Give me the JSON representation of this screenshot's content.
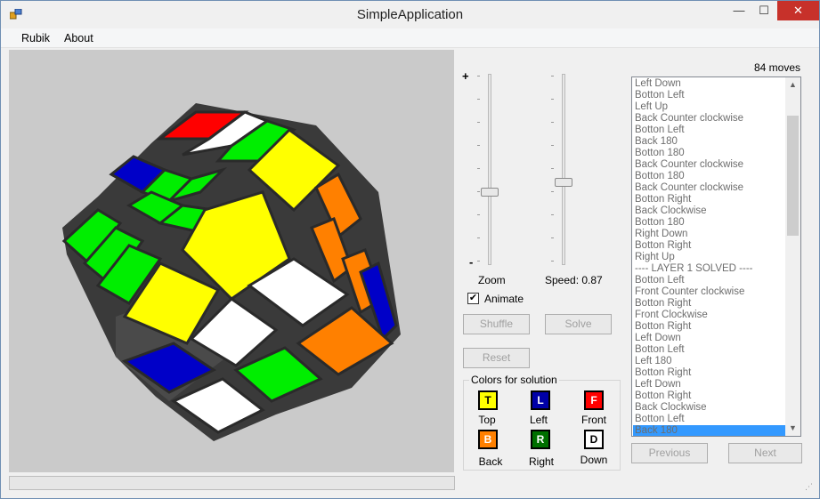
{
  "window": {
    "title": "SimpleApplication"
  },
  "menu": {
    "rubik": "Rubik",
    "about": "About"
  },
  "controls": {
    "zoom_plus": "+",
    "zoom_minus": "-",
    "zoom_label": "Zoom",
    "speed_label": "Speed: 0.87",
    "animate_label": "Animate",
    "animate_checked": true,
    "shuffle": "Shuffle",
    "solve": "Solve",
    "reset": "Reset",
    "previous": "Previous",
    "next": "Next"
  },
  "colors": {
    "title": "Colors for solution",
    "items": [
      {
        "letter": "T",
        "name": "Top",
        "color": "#ffff00",
        "text": "#000000"
      },
      {
        "letter": "L",
        "name": "Left",
        "color": "#0000a8",
        "text": "#ffffff"
      },
      {
        "letter": "F",
        "name": "Front",
        "color": "#ff0000",
        "text": "#ffffff"
      },
      {
        "letter": "B",
        "name": "Back",
        "color": "#ff8000",
        "text": "#ffffff"
      },
      {
        "letter": "R",
        "name": "Right",
        "color": "#007000",
        "text": "#ffffff"
      },
      {
        "letter": "D",
        "name": "Down",
        "color": "#ffffff",
        "text": "#000000"
      }
    ]
  },
  "moves": {
    "count": "84 moves",
    "items": [
      "Left Down",
      "Botton Left",
      "Left Up",
      "Back Counter clockwise",
      "Botton Left",
      "Back 180",
      "Botton 180",
      "Back Counter clockwise",
      "Botton 180",
      "Back Counter clockwise",
      "Botton Right",
      "Back Clockwise",
      "Botton 180",
      "Right Down",
      "Botton Right",
      "Right Up",
      "---- LAYER 1 SOLVED ----",
      "Botton Left",
      "Front Counter clockwise",
      "Botton Right",
      "Front Clockwise",
      "Botton Right",
      "Left Down",
      "Botton Left",
      "Left 180",
      "Botton Right",
      "Left Down",
      "Botton Right",
      "Back Clockwise",
      "Botton Left",
      "Back 180"
    ],
    "selected_index": 30
  }
}
